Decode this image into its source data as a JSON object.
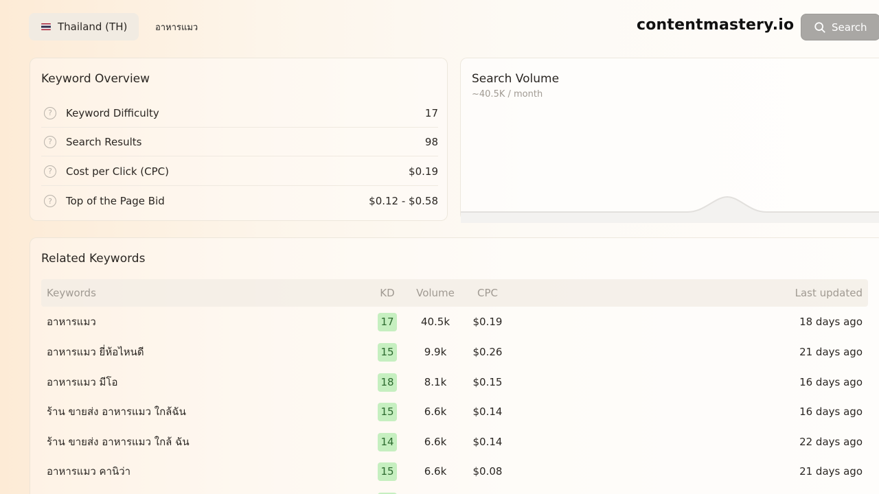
{
  "header": {
    "country_label": "Thailand (TH)",
    "query_value": "อาหารแมว",
    "brand": "contentmastery.io",
    "search_label": "Search"
  },
  "overview": {
    "title": "Keyword Overview",
    "rows": [
      {
        "label": "Keyword Difficulty",
        "value": "17"
      },
      {
        "label": "Search Results",
        "value": "98"
      },
      {
        "label": "Cost per Click (CPC)",
        "value": "$0.19"
      },
      {
        "label": "Top of the Page Bid",
        "value": "$0.12 - $0.58"
      }
    ]
  },
  "volume": {
    "title": "Search Volume",
    "subtitle": "~40.5K / month"
  },
  "related": {
    "title": "Related Keywords",
    "columns": {
      "keywords": "Keywords",
      "kd": "KD",
      "volume": "Volume",
      "cpc": "CPC",
      "updated": "Last updated"
    },
    "rows": [
      {
        "keyword": "อาหารแมว",
        "kd": "17",
        "volume": "40.5k",
        "cpc": "$0.19",
        "updated": "18 days ago"
      },
      {
        "keyword": "อาหารแมว ยี่ห้อไหนดี",
        "kd": "15",
        "volume": "9.9k",
        "cpc": "$0.26",
        "updated": "21 days ago"
      },
      {
        "keyword": "อาหารแมว มีโอ",
        "kd": "18",
        "volume": "8.1k",
        "cpc": "$0.15",
        "updated": "16 days ago"
      },
      {
        "keyword": "ร้าน ขายส่ง อาหารแมว ใกล้ฉัน",
        "kd": "15",
        "volume": "6.6k",
        "cpc": "$0.14",
        "updated": "16 days ago"
      },
      {
        "keyword": "ร้าน ขายส่ง อาหารแมว ใกล้ ฉัน",
        "kd": "14",
        "volume": "6.6k",
        "cpc": "$0.14",
        "updated": "22 days ago"
      },
      {
        "keyword": "อาหารแมว คานิว่า",
        "kd": "15",
        "volume": "6.6k",
        "cpc": "$0.08",
        "updated": "21 days ago"
      }
    ]
  },
  "colors": {
    "kd_badge_bg": "#c6efc0",
    "kd_badge_text": "#2c6a2e",
    "search_button": "#a9a7a4"
  }
}
